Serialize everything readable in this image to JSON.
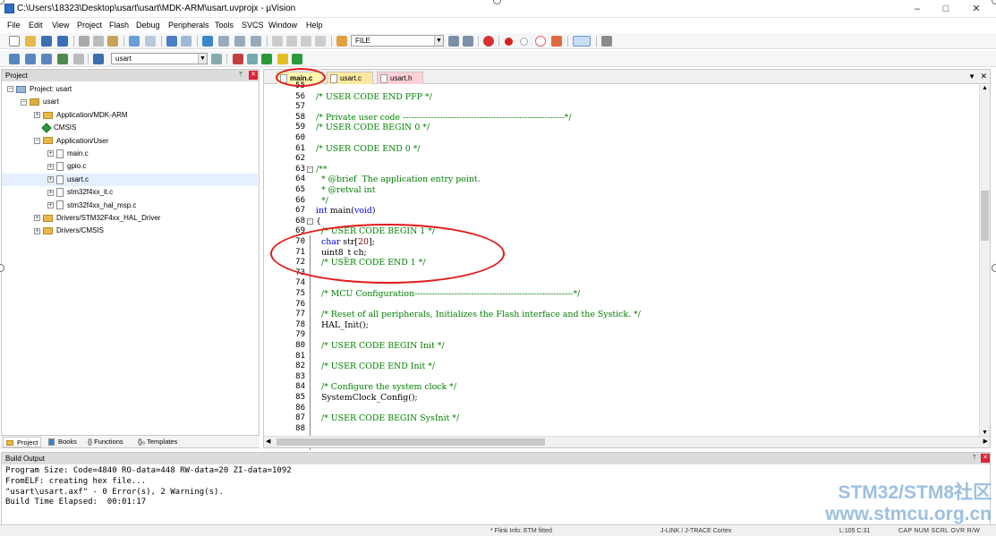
{
  "window": {
    "title": "C:\\Users\\18323\\Desktop\\usart\\usart\\MDK-ARM\\usart.uvprojx - µVision",
    "controls": [
      "–",
      "□",
      "✕"
    ]
  },
  "menu": [
    "File",
    "Edit",
    "View",
    "Project",
    "Flash",
    "Debug",
    "Peripherals",
    "Tools",
    "SVCS",
    "Window",
    "Help"
  ],
  "toolbar": {
    "find_combo_value": "FILE",
    "target_combo_value": "usart"
  },
  "project_panel": {
    "title": "Project",
    "tree": [
      {
        "label": "Project: usart",
        "indent": 0,
        "kind": "project",
        "expanded": true
      },
      {
        "label": "usart",
        "indent": 1,
        "kind": "target",
        "expanded": true
      },
      {
        "label": "Application/MDK-ARM",
        "indent": 2,
        "kind": "folder",
        "expanded": false
      },
      {
        "label": "CMSIS",
        "indent": 2,
        "kind": "component",
        "expanded": null
      },
      {
        "label": "Application/User",
        "indent": 2,
        "kind": "folder",
        "expanded": true
      },
      {
        "label": "main.c",
        "indent": 3,
        "kind": "file",
        "expanded": false
      },
      {
        "label": "gpio.c",
        "indent": 3,
        "kind": "file",
        "expanded": false
      },
      {
        "label": "usart.c",
        "indent": 3,
        "kind": "file",
        "expanded": false,
        "selected": true
      },
      {
        "label": "stm32f4xx_it.c",
        "indent": 3,
        "kind": "file",
        "expanded": false
      },
      {
        "label": "stm32f4xx_hal_msp.c",
        "indent": 3,
        "kind": "file",
        "expanded": false
      },
      {
        "label": "Drivers/STM32F4xx_HAL_Driver",
        "indent": 2,
        "kind": "folder",
        "expanded": false
      },
      {
        "label": "Drivers/CMSIS",
        "indent": 2,
        "kind": "folder",
        "expanded": false
      }
    ],
    "tabs": [
      "Project",
      "Books",
      "{} Functions",
      "{}₀ Templates"
    ]
  },
  "editor": {
    "tabs": [
      {
        "label": "main.c",
        "active": true,
        "color": "#fff9b0"
      },
      {
        "label": "usart.c",
        "active": false,
        "color": "#ffe8a0"
      },
      {
        "label": "usart.h",
        "active": false,
        "color": "#ffd1d6"
      }
    ],
    "lines": [
      {
        "n": "55",
        "parts": [
          {
            "t": "",
            "c": "txt"
          }
        ]
      },
      {
        "n": "56",
        "parts": [
          {
            "t": "/* USER CODE END PFP */",
            "c": "cmt"
          }
        ]
      },
      {
        "n": "57",
        "parts": [
          {
            "t": "",
            "c": "txt"
          }
        ]
      },
      {
        "n": "58",
        "parts": [
          {
            "t": "/* Private user code ---------------------------------------------------------*/",
            "c": "cmt"
          }
        ]
      },
      {
        "n": "59",
        "parts": [
          {
            "t": "/* USER CODE BEGIN 0 */",
            "c": "cmt"
          }
        ]
      },
      {
        "n": "60",
        "parts": [
          {
            "t": "",
            "c": "txt"
          }
        ]
      },
      {
        "n": "61",
        "parts": [
          {
            "t": "/* USER CODE END 0 */",
            "c": "cmt"
          }
        ]
      },
      {
        "n": "62",
        "parts": [
          {
            "t": "",
            "c": "txt"
          }
        ]
      },
      {
        "n": "63",
        "fold": "-",
        "parts": [
          {
            "t": "/**",
            "c": "cmt"
          }
        ]
      },
      {
        "n": "64",
        "parts": [
          {
            "t": "  * @brief  The application entry point.",
            "c": "cmt"
          }
        ]
      },
      {
        "n": "65",
        "parts": [
          {
            "t": "  * @retval int",
            "c": "cmt"
          }
        ]
      },
      {
        "n": "66",
        "parts": [
          {
            "t": "  */",
            "c": "cmt"
          }
        ]
      },
      {
        "n": "67",
        "parts": [
          {
            "t": "int",
            "c": "kw"
          },
          {
            "t": " main(",
            "c": "txt"
          },
          {
            "t": "void",
            "c": "kw"
          },
          {
            "t": ")",
            "c": "txt"
          }
        ]
      },
      {
        "n": "68",
        "fold": "-",
        "parts": [
          {
            "t": "{",
            "c": "txt"
          }
        ]
      },
      {
        "n": "69",
        "parts": [
          {
            "t": "  /* USER CODE BEGIN 1 */",
            "c": "cmt"
          }
        ]
      },
      {
        "n": "70",
        "parts": [
          {
            "t": "  ",
            "c": "txt"
          },
          {
            "t": "char",
            "c": "kw"
          },
          {
            "t": " str[",
            "c": "txt"
          },
          {
            "t": "20",
            "c": "num"
          },
          {
            "t": "];",
            "c": "txt"
          }
        ]
      },
      {
        "n": "71",
        "parts": [
          {
            "t": "  uint8_t ch;",
            "c": "txt"
          }
        ]
      },
      {
        "n": "72",
        "parts": [
          {
            "t": "  /* USER CODE END 1 */",
            "c": "cmt"
          }
        ]
      },
      {
        "n": "73",
        "parts": [
          {
            "t": "",
            "c": "txt"
          }
        ]
      },
      {
        "n": "74",
        "parts": [
          {
            "t": "",
            "c": "txt"
          }
        ]
      },
      {
        "n": "75",
        "parts": [
          {
            "t": "  /* MCU Configuration--------------------------------------------------------*/",
            "c": "cmt"
          }
        ]
      },
      {
        "n": "76",
        "parts": [
          {
            "t": "",
            "c": "txt"
          }
        ]
      },
      {
        "n": "77",
        "parts": [
          {
            "t": "  /* Reset of all peripherals, Initializes the Flash interface and the Systick. */",
            "c": "cmt"
          }
        ]
      },
      {
        "n": "78",
        "parts": [
          {
            "t": "  HAL_Init();",
            "c": "txt"
          }
        ]
      },
      {
        "n": "79",
        "parts": [
          {
            "t": "",
            "c": "txt"
          }
        ]
      },
      {
        "n": "80",
        "parts": [
          {
            "t": "  /* USER CODE BEGIN Init */",
            "c": "cmt"
          }
        ]
      },
      {
        "n": "81",
        "parts": [
          {
            "t": "",
            "c": "txt"
          }
        ]
      },
      {
        "n": "82",
        "parts": [
          {
            "t": "  /* USER CODE END Init */",
            "c": "cmt"
          }
        ]
      },
      {
        "n": "83",
        "parts": [
          {
            "t": "",
            "c": "txt"
          }
        ]
      },
      {
        "n": "84",
        "parts": [
          {
            "t": "  /* Configure the system clock */",
            "c": "cmt"
          }
        ]
      },
      {
        "n": "85",
        "parts": [
          {
            "t": "  SystemClock_Config();",
            "c": "txt"
          }
        ]
      },
      {
        "n": "86",
        "parts": [
          {
            "t": "",
            "c": "txt"
          }
        ]
      },
      {
        "n": "87",
        "parts": [
          {
            "t": "  /* USER CODE BEGIN SysInit */",
            "c": "cmt"
          }
        ]
      },
      {
        "n": "88",
        "parts": [
          {
            "t": "",
            "c": "txt"
          }
        ]
      }
    ]
  },
  "build_output": {
    "title": "Build Output",
    "lines": [
      "Program Size: Code=4840 RO-data=448 RW-data=20 ZI-data=1092",
      "FromELF: creating hex file...",
      "\"usart\\usart.axf\" - 0 Error(s), 2 Warning(s).",
      "Build Time Elapsed:  00:01:17"
    ]
  },
  "status_bar": {
    "link_info": "* Flink Info: ETM fitted",
    "debugger": "J-LINK / J-TRACE Cortex",
    "position": "L:105 C:31",
    "indicators": "CAP  NUM  SCRL  OVR  R/W"
  },
  "watermark": {
    "line1": "STM32/STM8社区",
    "line2": "www.stmcu.org.cn"
  },
  "colors": {
    "comment": "#008000",
    "keyword": "#0000ff",
    "number": "#800000",
    "annotation": "#e41919"
  }
}
